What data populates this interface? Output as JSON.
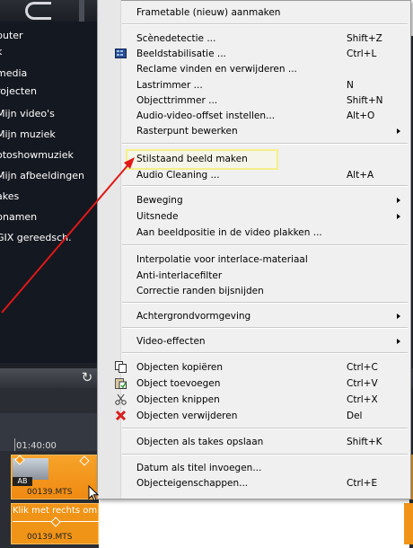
{
  "nav": {
    "items": [
      "puter",
      "k",
      "media",
      "rojecten",
      "Mijn video's",
      "Mijn muziek",
      "otoshowmuziek",
      "Mijn afbeeldingen",
      "akes",
      "pnamen",
      "GIX gereedsch."
    ]
  },
  "timeline": {
    "time_label": "01:40:00",
    "clip_name": "00139.MTS",
    "clip_badge": "AB",
    "track2_hint": "Klik met rechts om de ge...",
    "track2_clip_name": "00139.MTS"
  },
  "menu": {
    "items": [
      {
        "label": "Frametable (nieuw) aanmaken",
        "shortcut": "",
        "submenu": false,
        "icon": ""
      },
      {
        "label": "Scènedetectie ...",
        "shortcut": "Shift+Z",
        "submenu": false,
        "icon": ""
      },
      {
        "label": "Beeldstabilisatie ...",
        "shortcut": "Ctrl+L",
        "submenu": false,
        "icon": "stabilize-icon"
      },
      {
        "label": "Reclame vinden en verwijderen ...",
        "shortcut": "",
        "submenu": false,
        "icon": ""
      },
      {
        "label": "Lastrimmer ...",
        "shortcut": "N",
        "submenu": false,
        "icon": ""
      },
      {
        "label": "Objecttrimmer ...",
        "shortcut": "Shift+N",
        "submenu": false,
        "icon": ""
      },
      {
        "label": "Audio-video-offset instellen...",
        "shortcut": "Alt+O",
        "submenu": false,
        "icon": ""
      },
      {
        "label": "Rasterpunt bewerken",
        "shortcut": "",
        "submenu": true,
        "icon": ""
      },
      {
        "label": "Stilstaand beeld maken",
        "shortcut": "",
        "submenu": false,
        "icon": ""
      },
      {
        "label": "Audio Cleaning ...",
        "shortcut": "Alt+A",
        "submenu": false,
        "icon": ""
      },
      {
        "label": "Beweging",
        "shortcut": "",
        "submenu": true,
        "icon": ""
      },
      {
        "label": "Uitsnede",
        "shortcut": "",
        "submenu": true,
        "icon": ""
      },
      {
        "label": "Aan beeldpositie in de video plakken ...",
        "shortcut": "",
        "submenu": false,
        "icon": ""
      },
      {
        "label": "Interpolatie voor interlace-materiaal",
        "shortcut": "",
        "submenu": false,
        "icon": ""
      },
      {
        "label": "Anti-interlacefilter",
        "shortcut": "",
        "submenu": false,
        "icon": ""
      },
      {
        "label": "Correctie randen bijsnijden",
        "shortcut": "",
        "submenu": false,
        "icon": ""
      },
      {
        "label": "Achtergrondvormgeving",
        "shortcut": "",
        "submenu": true,
        "icon": ""
      },
      {
        "label": "Video-effecten",
        "shortcut": "",
        "submenu": true,
        "icon": ""
      },
      {
        "label": "Objecten kopiëren",
        "shortcut": "Ctrl+C",
        "submenu": false,
        "icon": "copy-icon"
      },
      {
        "label": "Object toevoegen",
        "shortcut": "Ctrl+V",
        "submenu": false,
        "icon": "paste-icon"
      },
      {
        "label": "Objecten knippen",
        "shortcut": "Ctrl+X",
        "submenu": false,
        "icon": "cut-icon"
      },
      {
        "label": "Objecten verwijderen",
        "shortcut": "Del",
        "submenu": false,
        "icon": "delete-icon"
      },
      {
        "label": "Objecten als takes opslaan",
        "shortcut": "Shift+K",
        "submenu": false,
        "icon": ""
      },
      {
        "label": "Datum als titel invoegen...",
        "shortcut": "",
        "submenu": false,
        "icon": ""
      },
      {
        "label": "Objecteigenschappen...",
        "shortcut": "Ctrl+E",
        "submenu": false,
        "icon": ""
      }
    ]
  },
  "colors": {
    "highlight_box": "#f4f08a",
    "annotation_arrow": "#e01818",
    "clip_orange": "#f6a329",
    "delete_red": "#d81e1e"
  }
}
